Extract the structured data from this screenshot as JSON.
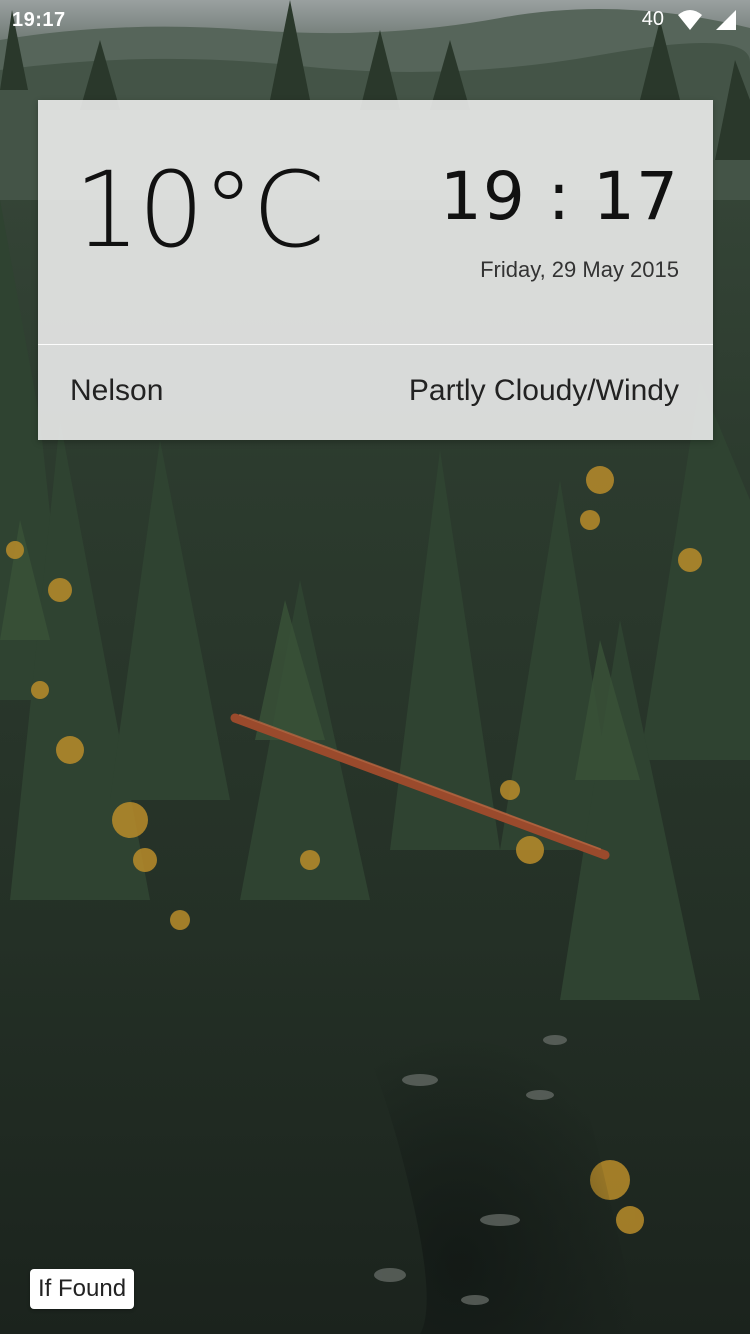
{
  "status_bar": {
    "time": "19:17",
    "signal_text": "40",
    "icons": [
      "wifi-icon",
      "cell-signal-icon"
    ]
  },
  "widget": {
    "temperature": "10°C",
    "clock": "19 : 17",
    "date": "Friday, 29 May 2015",
    "location": "Nelson",
    "condition": "Partly Cloudy/Windy"
  },
  "footer": {
    "if_found_label": "If Found"
  },
  "colors": {
    "forest_dark": "#1f2a22",
    "card_bg": "#f0f0f0",
    "text_dark": "#111111",
    "log_rust": "#9a4a2c"
  }
}
